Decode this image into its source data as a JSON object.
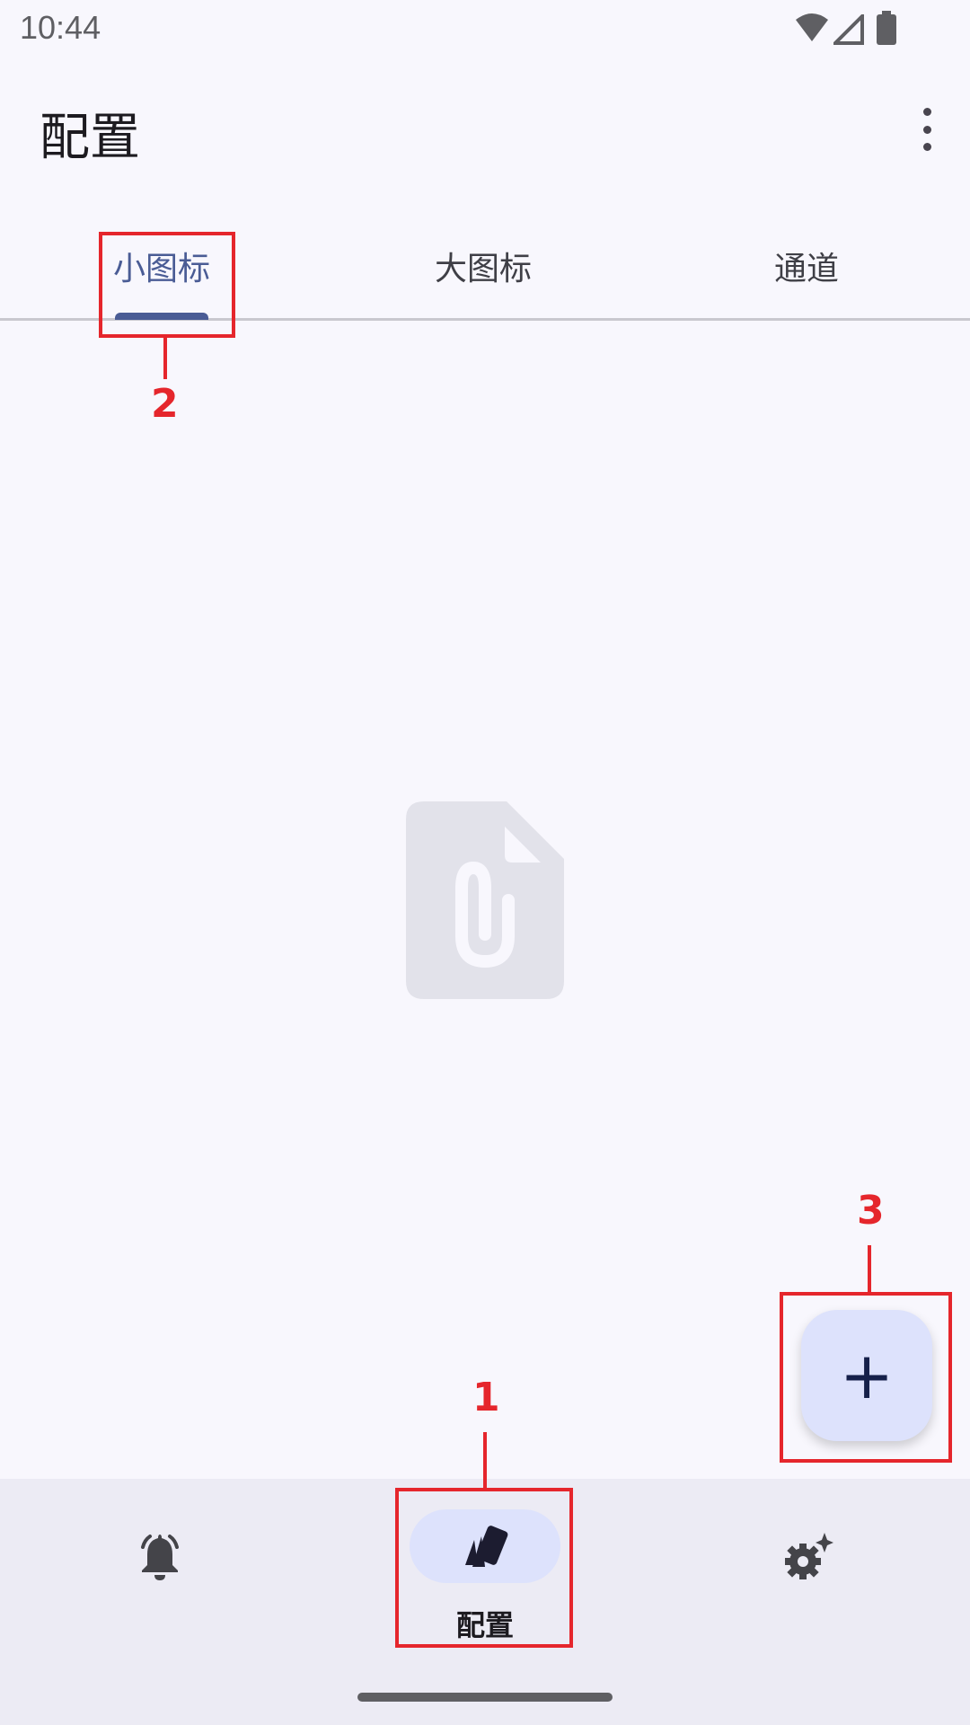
{
  "status_bar": {
    "time": "10:44"
  },
  "app_bar": {
    "title": "配置"
  },
  "tabs": [
    {
      "label": "小图标",
      "selected": true
    },
    {
      "label": "大图标",
      "selected": false
    },
    {
      "label": "通道",
      "selected": false
    }
  ],
  "bottom_nav": {
    "items": [
      {
        "icon": "bell-icon"
      },
      {
        "icon": "cards-icon",
        "label": "配置",
        "selected": true
      },
      {
        "icon": "settings-gear-sparkle-icon"
      }
    ]
  },
  "fab": {
    "glyph": "+"
  },
  "annotations": [
    "1",
    "2",
    "3"
  ],
  "colors": {
    "accent": "#4a5c95",
    "fab_bg": "#dde2fc",
    "background": "#f8f7fd",
    "nav_bg": "#ecebf4",
    "annotation": "#e5262c"
  }
}
